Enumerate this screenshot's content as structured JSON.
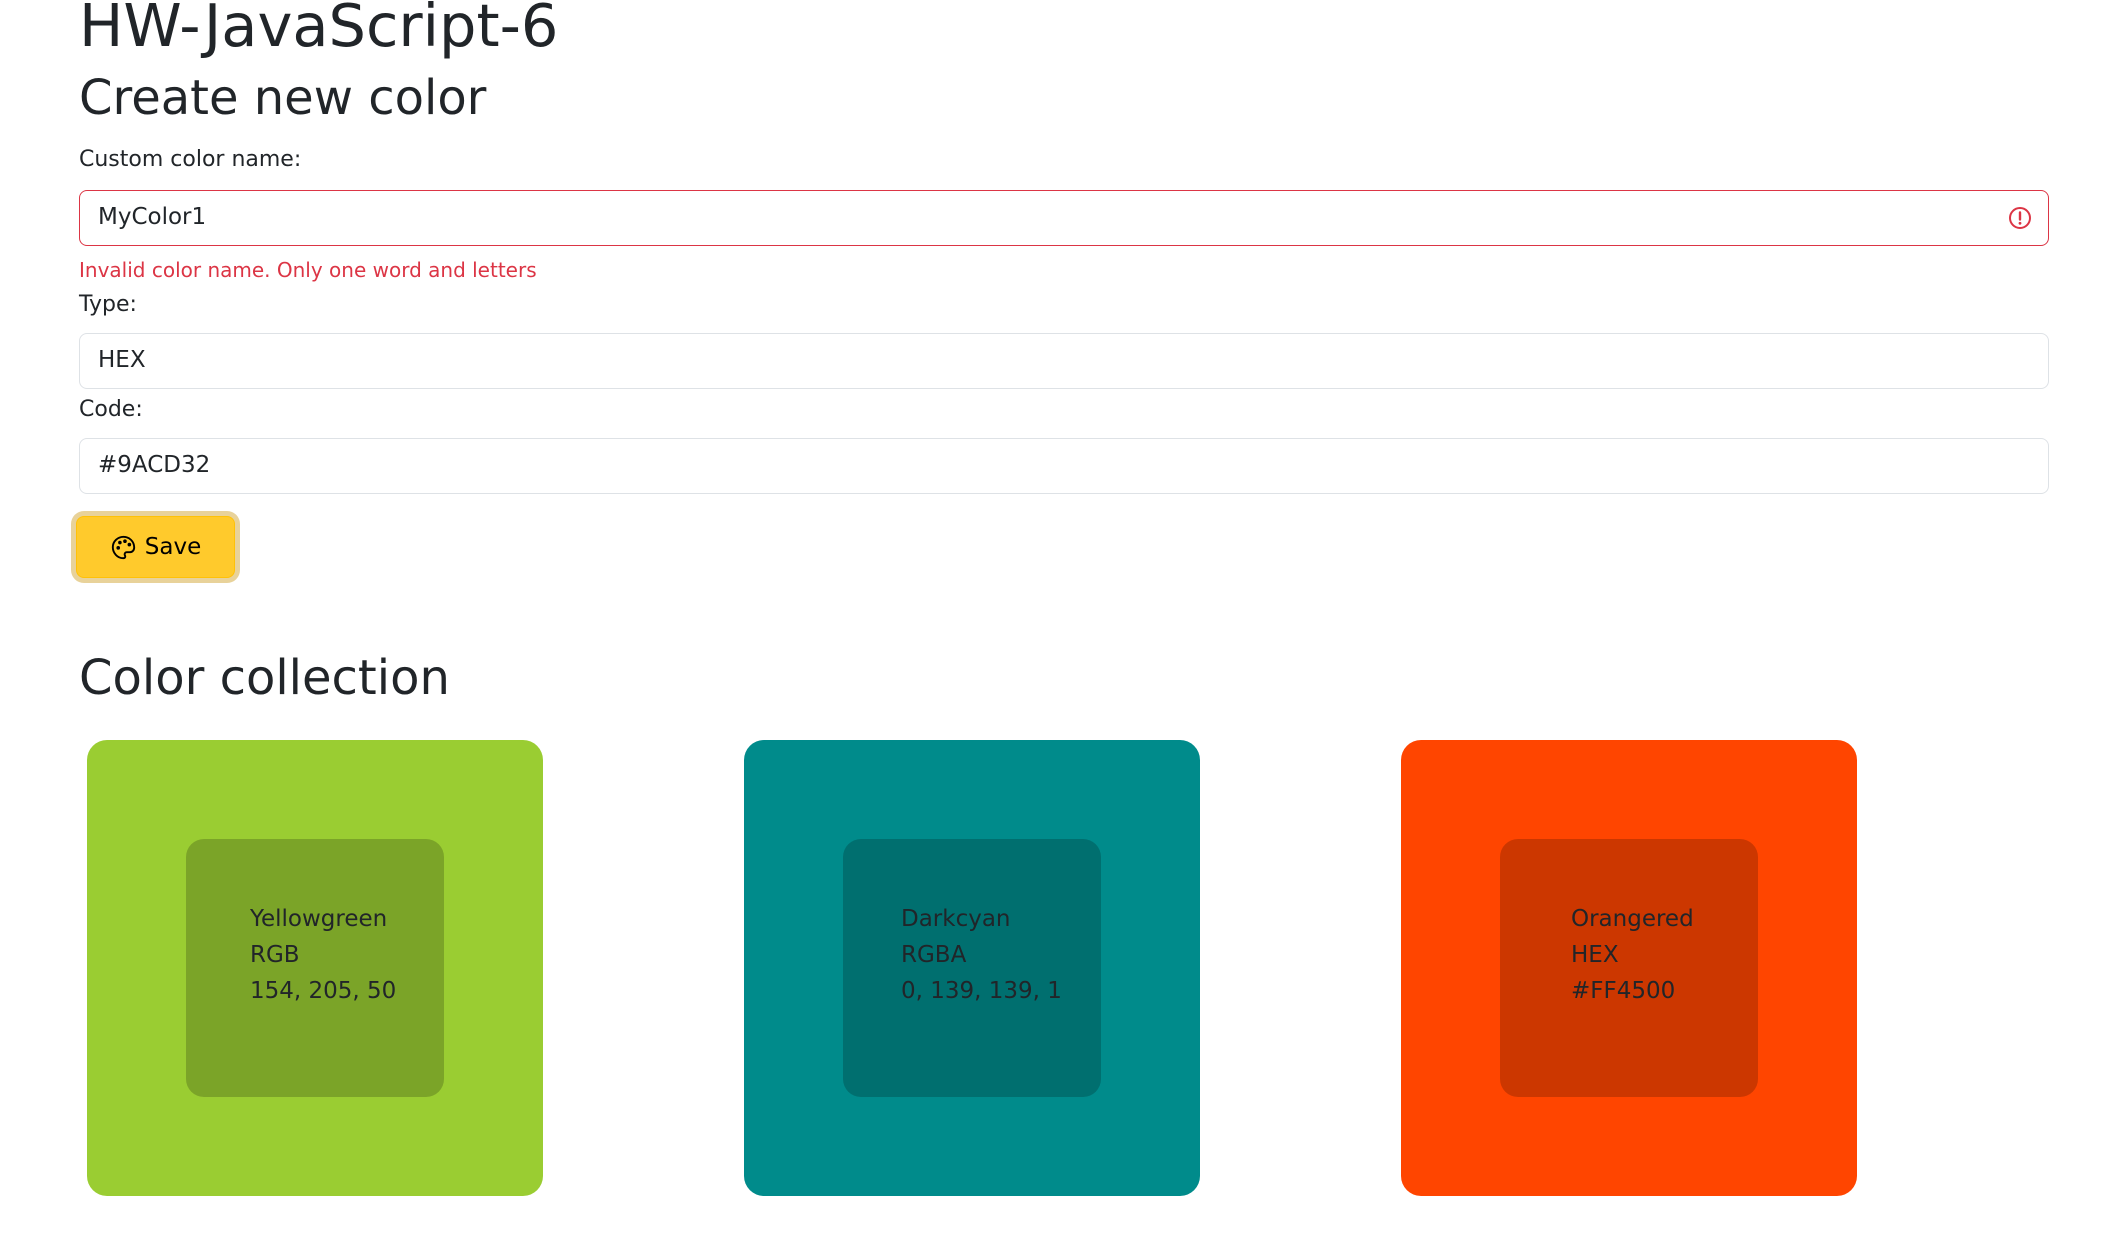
{
  "header": {
    "title": "HW-JavaScript-6"
  },
  "form": {
    "heading": "Create new color",
    "name_label": "Custom color name:",
    "name_value": "MyColor1",
    "name_error": "Invalid color name. Only one word and letters",
    "type_label": "Type:",
    "type_value": "HEX",
    "code_label": "Code:",
    "code_value": "#9ACD32",
    "save_label": "Save",
    "save_icon": "palette-icon",
    "error_icon": "exclamation-circle-icon",
    "colors": {
      "error": "#dc3545",
      "save_button": "#ffca2c"
    }
  },
  "collection": {
    "heading": "Color collection",
    "cards": [
      {
        "name": "Yellowgreen",
        "type": "RGB",
        "code": "154, 205, 50",
        "color": "#9acd32"
      },
      {
        "name": "Darkcyan",
        "type": "RGBA",
        "code": "0, 139, 139, 1",
        "color": "#008b8b"
      },
      {
        "name": "Orangered",
        "type": "HEX",
        "code": "#FF4500",
        "color": "#ff4500"
      }
    ]
  }
}
